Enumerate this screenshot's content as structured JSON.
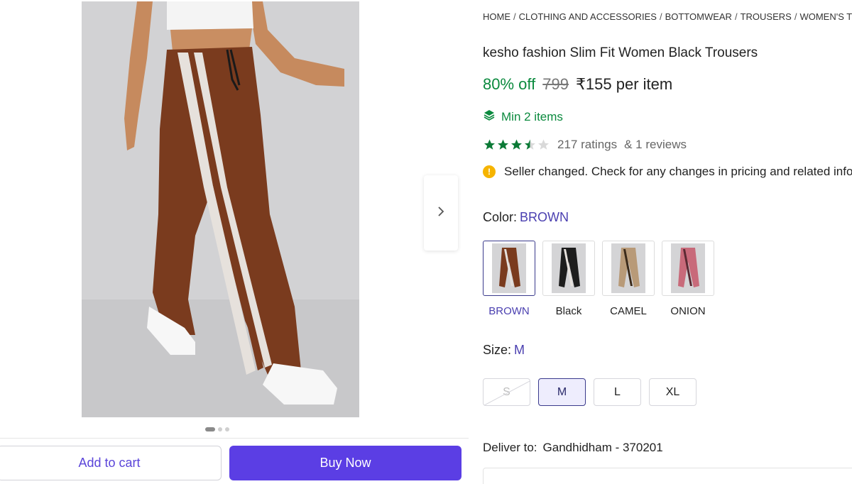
{
  "breadcrumb": [
    "HOME",
    "CLOTHING AND ACCESSORIES",
    "BOTTOMWEAR",
    "TROUSERS",
    "WOMEN'S TROUSE"
  ],
  "product": {
    "title": "kesho fashion Slim Fit Women Black Trousers",
    "discount": "80% off",
    "mrp": "799",
    "price": "₹155 per item",
    "min_items": "Min 2 items",
    "rating_value": 3.5,
    "ratings_text": "217 ratings",
    "reviews_text": "& 1 reviews",
    "notice": "Seller changed. Check for any changes in pricing and related infor"
  },
  "color": {
    "label": "Color:",
    "selected": "BROWN",
    "options": [
      {
        "label": "BROWN",
        "shade": "#7a3b1e"
      },
      {
        "label": "Black",
        "shade": "#1d1d1d"
      },
      {
        "label": "CAMEL",
        "shade": "#b89a78"
      },
      {
        "label": "ONION",
        "shade": "#c86a7a"
      }
    ]
  },
  "size": {
    "label": "Size:",
    "selected": "M",
    "options": [
      {
        "label": "S",
        "available": false
      },
      {
        "label": "M",
        "available": true
      },
      {
        "label": "L",
        "available": true
      },
      {
        "label": "XL",
        "available": true
      }
    ]
  },
  "gallery": {
    "image_count": 3,
    "active_index": 0,
    "next_icon": "chevron-right-icon"
  },
  "actions": {
    "add_to_cart": "Add to cart",
    "buy_now": "Buy Now"
  },
  "delivery": {
    "label": "Deliver to:",
    "location": "Gandhidham - 370201"
  },
  "colors": {
    "accent": "#5b3ee4",
    "green": "#0b8a3e",
    "link": "#4a3fb0",
    "warning": "#f6b400"
  }
}
